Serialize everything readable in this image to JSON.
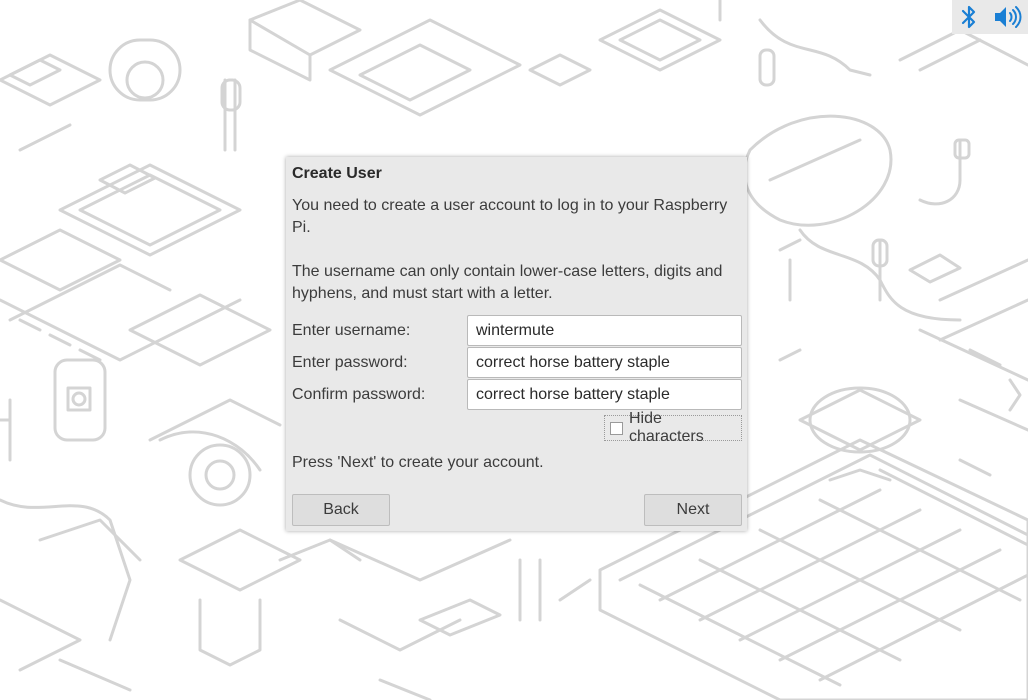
{
  "tray": {
    "bluetooth_icon": "bluetooth-icon",
    "volume_icon": "volume-icon",
    "accent_color": "#1a7fd4"
  },
  "dialog": {
    "title": "Create User",
    "intro": "You need to create a user account to log in to your Raspberry Pi.",
    "rules": "The username can only contain lower-case letters, digits and hyphens, and must start with a letter.",
    "username_label": "Enter username:",
    "username_value": "wintermute",
    "password_label": "Enter password:",
    "password_value": "correct horse battery staple",
    "confirm_label": "Confirm password:",
    "confirm_value": "correct horse battery staple",
    "hide_characters_label": "Hide characters",
    "hide_characters_checked": false,
    "instruction": "Press 'Next' to create your account.",
    "back_label": "Back",
    "next_label": "Next"
  }
}
